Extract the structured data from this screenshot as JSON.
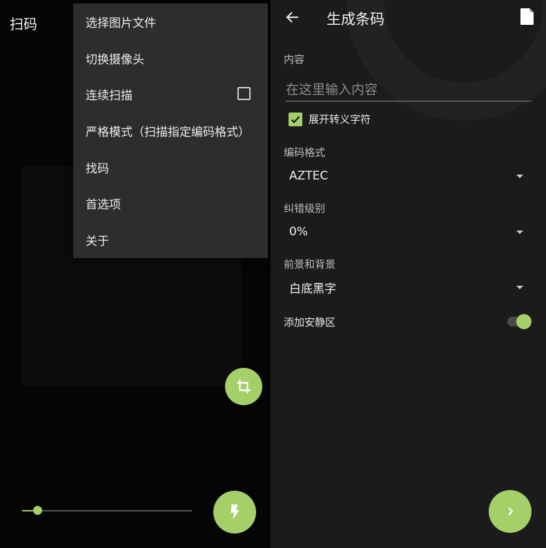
{
  "left": {
    "title": "扫码",
    "menu": [
      {
        "label": "选择图片文件"
      },
      {
        "label": "切换摄像头"
      },
      {
        "label": "连续扫描",
        "checkbox": false
      },
      {
        "label": "严格模式（扫描指定编码格式）"
      },
      {
        "label": "找码"
      },
      {
        "label": "首选项"
      },
      {
        "label": "关于"
      }
    ],
    "zoom": {
      "value_percent": 9
    },
    "icons": {
      "crop": "crop-icon",
      "flash": "flash-icon"
    }
  },
  "right": {
    "title": "生成条码",
    "icons": {
      "back": "arrow-left-icon",
      "file": "file-icon",
      "next": "chevron-right-icon"
    },
    "content_label": "内容",
    "content_placeholder": "在这里输入内容",
    "content_value": "",
    "escape_label": "展开转义字符",
    "escape_checked": true,
    "format_label": "编码格式",
    "format_value": "AZTEC",
    "ecc_label": "纠错级别",
    "ecc_value": "0%",
    "color_label": "前景和背景",
    "color_value": "白底黑字",
    "quiet_zone_label": "添加安静区",
    "quiet_zone_on": true
  },
  "colors": {
    "accent": "#a5cf68",
    "menu_bg": "#2d2d2d",
    "panel_bg": "#1b1b1b"
  }
}
